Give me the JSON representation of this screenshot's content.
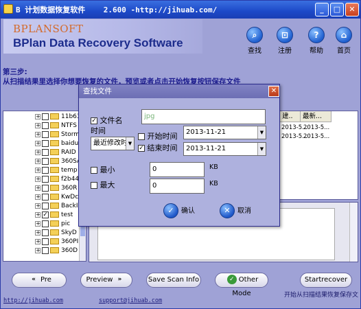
{
  "window": {
    "title": "B 计划数据恢复软件    2.600 -http://jihuab.com/",
    "min_glyph": "_",
    "max_glyph": "□",
    "close_glyph": "✕"
  },
  "header": {
    "logo_top": "BPLANSOFT",
    "logo_main": "BPlan Data Recovery Software",
    "buttons": [
      {
        "label": "查找",
        "glyph": "⌕"
      },
      {
        "label": "注册",
        "glyph": "⊡"
      },
      {
        "label": "帮助",
        "glyph": "?"
      },
      {
        "label": "首页",
        "glyph": "⌂"
      }
    ]
  },
  "step": {
    "line1": "第三步:",
    "line2": "从扫描结果里选择你想要恢复的文件，预览或者点击开始恢复按钮保存文件"
  },
  "tree": {
    "items": [
      {
        "label": "11b63",
        "checked": false
      },
      {
        "label": "NTFS",
        "checked": false
      },
      {
        "label": "Storm",
        "checked": false
      },
      {
        "label": "baidu",
        "checked": false
      },
      {
        "label": "RAID",
        "checked": false
      },
      {
        "label": "360SA",
        "checked": false
      },
      {
        "label": "temp",
        "checked": false
      },
      {
        "label": "f2b44",
        "checked": false
      },
      {
        "label": "360R",
        "checked": false
      },
      {
        "label": "KwDc",
        "checked": false
      },
      {
        "label": "BackI",
        "checked": false
      },
      {
        "label": "test",
        "checked": true
      },
      {
        "label": "pic",
        "checked": false
      },
      {
        "label": "SkyD",
        "checked": false
      },
      {
        "label": "360PI",
        "checked": false
      },
      {
        "label": "360D",
        "checked": false
      }
    ]
  },
  "list": {
    "columns": [
      "建..",
      "最新..."
    ],
    "rows": [
      [
        "2013-5...",
        "2013-5..."
      ],
      [
        "2013-5...",
        "2013-5..."
      ]
    ]
  },
  "dialog": {
    "title": "查找文件",
    "close": "✕",
    "filename_label": "文件名",
    "filename_value": "jpg",
    "time_label": "时间",
    "time_mode": "最近修改时间",
    "start_label": "开始时间",
    "start_value": "2013-11-21",
    "end_label": "结束时间",
    "end_value": "2013-11-21",
    "min_label": "最小",
    "min_value": "0",
    "max_label": "最大",
    "max_value": "0",
    "unit": "KB",
    "ok_label": "确认",
    "cancel_label": "取消"
  },
  "bottom": {
    "pre": "Pre",
    "preview": "Preview",
    "save_scan": "Save Scan Info",
    "other_mode": "Other Mode",
    "start_recover": "Startrecover",
    "link_site": "http://jihuab.com",
    "link_mail": "support@jihuab.com",
    "status": "开始从扫描结果恢复保存文"
  },
  "colors": {
    "window_bg": "#9fa2d6",
    "title_blue": "#1d49c8",
    "step_text": "#1d1d8f",
    "dialog_bg": "#aeb1de"
  }
}
